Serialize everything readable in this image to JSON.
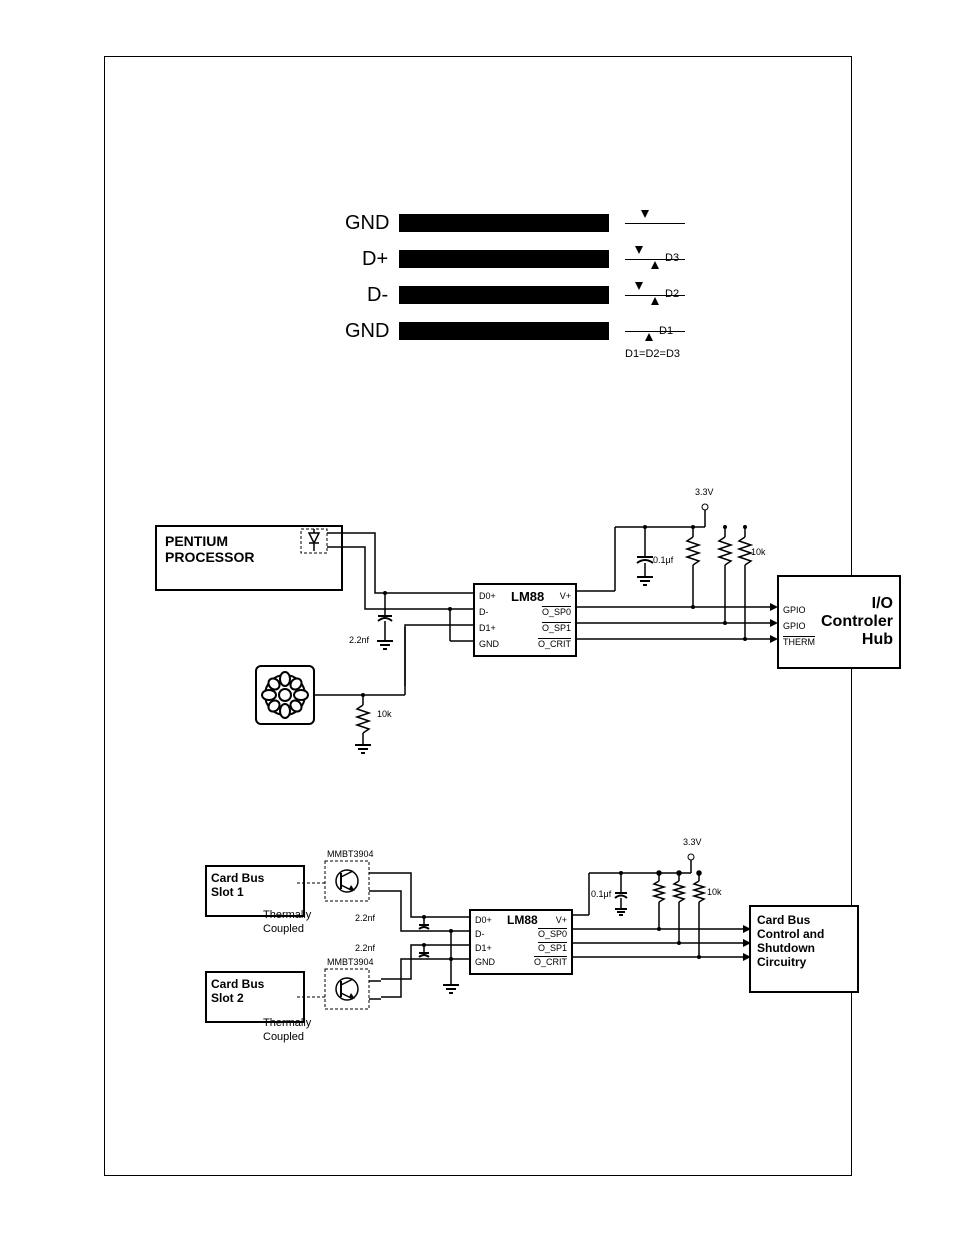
{
  "top_figure": {
    "rows": [
      {
        "label": "GND",
        "right": ""
      },
      {
        "label": "D+",
        "right": "D3"
      },
      {
        "label": "D-",
        "right": "D2"
      },
      {
        "label": "GND",
        "right": "D1"
      }
    ],
    "note": "D1=D2=D3"
  },
  "middle_circuit": {
    "cpu": "PENTIUM",
    "cpu2": "PROCESSOR",
    "chip": "LM88",
    "chip_pins_left": [
      "D0+",
      "D-",
      "D1+",
      "GND"
    ],
    "chip_pins_right_top": "V+",
    "chip_pins_right": [
      "O_SP0",
      "O_SP1",
      "O_CRIT"
    ],
    "vcc": "3.3V",
    "cap": "0.1μf",
    "r_pull": "10k",
    "r_pull2": "10k",
    "cap_cpu": "2.2nf",
    "hub_title": "I/O",
    "hub_line2": "Controler",
    "hub_line3": "Hub",
    "hub_pins": [
      "GPIO",
      "GPIO",
      "THERM"
    ]
  },
  "bottom_circuit": {
    "slot1": "Card Bus",
    "slot1b": "Slot 1",
    "slot2": "Card Bus",
    "slot2b": "Slot 2",
    "transistor": "MMBT3904",
    "thermal": "Thermally",
    "coupled": "Coupled",
    "cap_in": "2.2nf",
    "chip": "LM88",
    "chip_pins_left": [
      "D0+",
      "D-",
      "D1+",
      "GND"
    ],
    "chip_pins_right_top": "V+",
    "chip_pins_right": [
      "O_SP0",
      "O_SP1",
      "O_CRIT"
    ],
    "vcc": "3.3V",
    "cap": "0.1μf",
    "r_pull": "10k",
    "out_title": "Card Bus",
    "out_line2": "Control and",
    "out_line3": "Shutdown",
    "out_line4": "Circuitry"
  }
}
